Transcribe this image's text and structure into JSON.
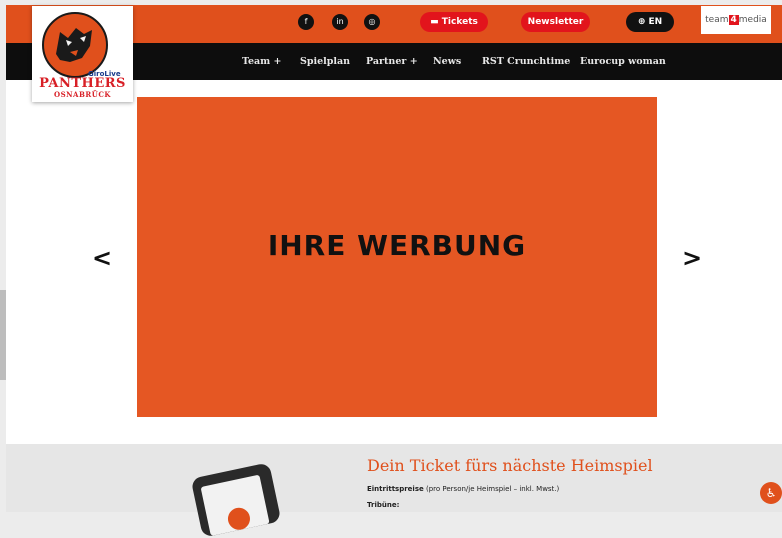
{
  "header": {
    "logo": {
      "sponsor": "GiroLive",
      "name": "PANTHERS",
      "city": "OSNABRÜCK"
    },
    "social": [
      {
        "icon": "facebook-icon",
        "glyph": "f"
      },
      {
        "icon": "linkedin-icon",
        "glyph": "in"
      },
      {
        "icon": "instagram-icon",
        "glyph": "◎"
      }
    ],
    "tickets_label": "Tickets",
    "newsletter_label": "Newsletter",
    "language_label": "EN",
    "partner_logo": {
      "pre": "team",
      "mid": "4",
      "post": "media"
    }
  },
  "nav": {
    "items": [
      {
        "label": "Team +"
      },
      {
        "label": "Spielplan"
      },
      {
        "label": "Partner +"
      },
      {
        "label": "News"
      },
      {
        "label": "RST Crunchtime"
      },
      {
        "label": "Eurocup woman"
      }
    ]
  },
  "slider": {
    "banner_text": "IHRE WERBUNG",
    "prev": "<",
    "next": ">"
  },
  "ticket": {
    "title": "Dein Ticket fürs nächste Heimspiel",
    "prices_label": "Eintrittspreise",
    "prices_note": "(pro Person/je Heimspiel – inkl. Mwst.)",
    "tribune_label": "Tribüne:"
  },
  "colors": {
    "brand_orange": "#e0501c",
    "ticket_red": "#e2141c",
    "nav_black": "#0d0d0d"
  }
}
